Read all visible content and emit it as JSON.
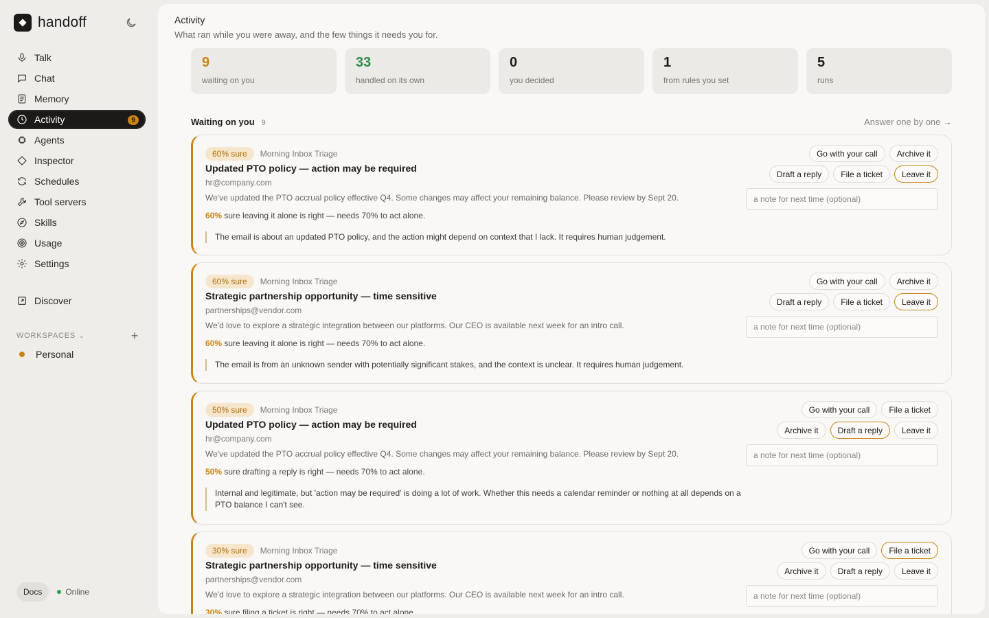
{
  "app": {
    "name": "handoff"
  },
  "theme": {
    "accent": "#c98413",
    "success": "#2e8b46",
    "sidebar_active_bg": "#1b1a18"
  },
  "sidebar": {
    "items": [
      {
        "label": "Talk",
        "icon": "microphone-icon"
      },
      {
        "label": "Chat",
        "icon": "chat-bubble-icon"
      },
      {
        "label": "Memory",
        "icon": "document-icon"
      },
      {
        "label": "Activity",
        "icon": "clock-icon",
        "badge": "9",
        "active": true
      },
      {
        "label": "Agents",
        "icon": "chip-icon"
      },
      {
        "label": "Inspector",
        "icon": "diamond-icon"
      },
      {
        "label": "Schedules",
        "icon": "refresh-icon"
      },
      {
        "label": "Tool servers",
        "icon": "wrench-icon"
      },
      {
        "label": "Skills",
        "icon": "compass-icon"
      },
      {
        "label": "Usage",
        "icon": "target-icon"
      },
      {
        "label": "Settings",
        "icon": "gear-icon"
      }
    ],
    "discover": {
      "label": "Discover",
      "icon": "external-link-icon"
    },
    "workspaces": {
      "header": "WORKSPACES",
      "items": [
        {
          "label": "Personal"
        }
      ]
    },
    "footer": {
      "docs": "Docs",
      "status": "Online"
    }
  },
  "page": {
    "title": "Activity",
    "subtitle": "What ran while you were away, and the few things it needs you for."
  },
  "stats": [
    {
      "value": "9",
      "label": "waiting on you",
      "color": "amber"
    },
    {
      "value": "33",
      "label": "handled on its own",
      "color": "green"
    },
    {
      "value": "0",
      "label": "you decided",
      "color": "default"
    },
    {
      "value": "1",
      "label": "from rules you set",
      "color": "default"
    },
    {
      "value": "5",
      "label": "runs",
      "color": "default"
    }
  ],
  "section": {
    "title": "Waiting on you",
    "count": "9",
    "link": "Answer one by one →"
  },
  "note_placeholder": "a note for next time (optional)",
  "cards": [
    {
      "sure": "60% sure",
      "agent": "Morning Inbox Triage",
      "title": "Updated PTO policy — action may be required",
      "sender": "hr@company.com",
      "preview": "We've updated the PTO accrual policy effective Q4. Some changes may affect your remaining balance. Please review by Sept 20.",
      "confidence_pct": "60%",
      "confidence_text": "sure leaving it alone is right — needs 70% to act alone.",
      "reason": "The email is about an updated PTO policy, and the action might depend on context that I lack. It requires human judgement.",
      "row1": [
        "Go with your call",
        "Archive it"
      ],
      "row2": [
        "Draft a reply",
        "File a ticket",
        "Leave it"
      ],
      "recommended": "Leave it"
    },
    {
      "sure": "60% sure",
      "agent": "Morning Inbox Triage",
      "title": "Strategic partnership opportunity — time sensitive",
      "sender": "partnerships@vendor.com",
      "preview": "We'd love to explore a strategic integration between our platforms. Our CEO is available next week for an intro call.",
      "confidence_pct": "60%",
      "confidence_text": "sure leaving it alone is right — needs 70% to act alone.",
      "reason": "The email is from an unknown sender with potentially significant stakes, and the context is unclear. It requires human judgement.",
      "row1": [
        "Go with your call",
        "Archive it"
      ],
      "row2": [
        "Draft a reply",
        "File a ticket",
        "Leave it"
      ],
      "recommended": "Leave it"
    },
    {
      "sure": "50% sure",
      "agent": "Morning Inbox Triage",
      "title": "Updated PTO policy — action may be required",
      "sender": "hr@company.com",
      "preview": "We've updated the PTO accrual policy effective Q4. Some changes may affect your remaining balance. Please review by Sept 20.",
      "confidence_pct": "50%",
      "confidence_text": "sure drafting a reply is right — needs 70% to act alone.",
      "reason": "Internal and legitimate, but 'action may be required' is doing a lot of work. Whether this needs a calendar reminder or nothing at all depends on a PTO balance I can't see.",
      "row1": [
        "Go with your call",
        "File a ticket"
      ],
      "row2": [
        "Archive it",
        "Draft a reply",
        "Leave it"
      ],
      "recommended": "Draft a reply"
    },
    {
      "sure": "30% sure",
      "agent": "Morning Inbox Triage",
      "title": "Strategic partnership opportunity — time sensitive",
      "sender": "partnerships@vendor.com",
      "preview": "We'd love to explore a strategic integration between our platforms. Our CEO is available next week for an intro call.",
      "confidence_pct": "30%",
      "confidence_text": "sure filing a ticket is right — needs 70% to act alone.",
      "reason": "",
      "row1": [
        "Go with your call",
        "File a ticket"
      ],
      "row2": [
        "Archive it",
        "Draft a reply",
        "Leave it"
      ],
      "recommended": "File a ticket"
    }
  ]
}
